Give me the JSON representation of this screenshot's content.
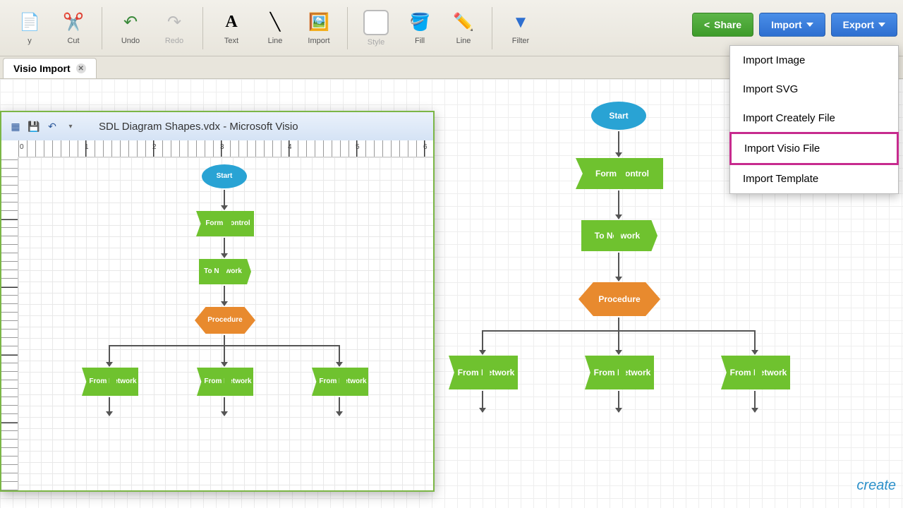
{
  "toolbar": {
    "copy": "y",
    "cut": "Cut",
    "undo": "Undo",
    "redo": "Redo",
    "text": "Text",
    "line": "Line",
    "import": "Import",
    "style": "Style",
    "fill": "Fill",
    "line2": "Line",
    "filter": "Filter"
  },
  "buttons": {
    "share": "Share",
    "import": "Import",
    "export": "Export"
  },
  "tab": {
    "title": "Visio Import"
  },
  "dropdown": {
    "items": [
      "Import Image",
      "Import SVG",
      "Import Creately File",
      "Import Visio File",
      "Import Template"
    ],
    "highlighted_index": 3
  },
  "visio": {
    "title": "SDL Diagram Shapes.vdx  -  Microsoft Visio",
    "ruler_marks": [
      "0",
      "1",
      "2",
      "3",
      "4",
      "5",
      "6"
    ]
  },
  "flowchart": {
    "start": "Start",
    "form_control": "Form Control",
    "to_network": "To Network",
    "procedure": "Procedure",
    "from_network": "From Network"
  },
  "logo": "create"
}
